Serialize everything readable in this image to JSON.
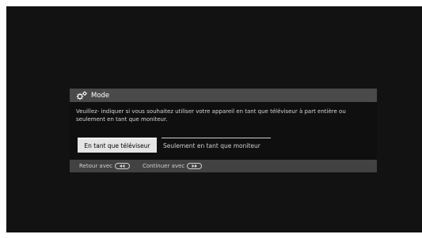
{
  "dialog": {
    "title": "Mode",
    "title_icon": "gears-icon",
    "message": "Veuillez- indiquer si vous souhaitez utiliser votre appareil en tant que téléviseur à part entière ou seulement en tant que moniteur.",
    "options": {
      "tv": "En tant que téléviseur",
      "monitor": "Seulement en tant que moniteur"
    },
    "selected_option": "tv"
  },
  "footer": {
    "back_label": "Retour avec",
    "back_icon": "rewind-button-icon",
    "continue_label": "Continuer avec",
    "continue_icon": "fast-forward-button-icon"
  }
}
